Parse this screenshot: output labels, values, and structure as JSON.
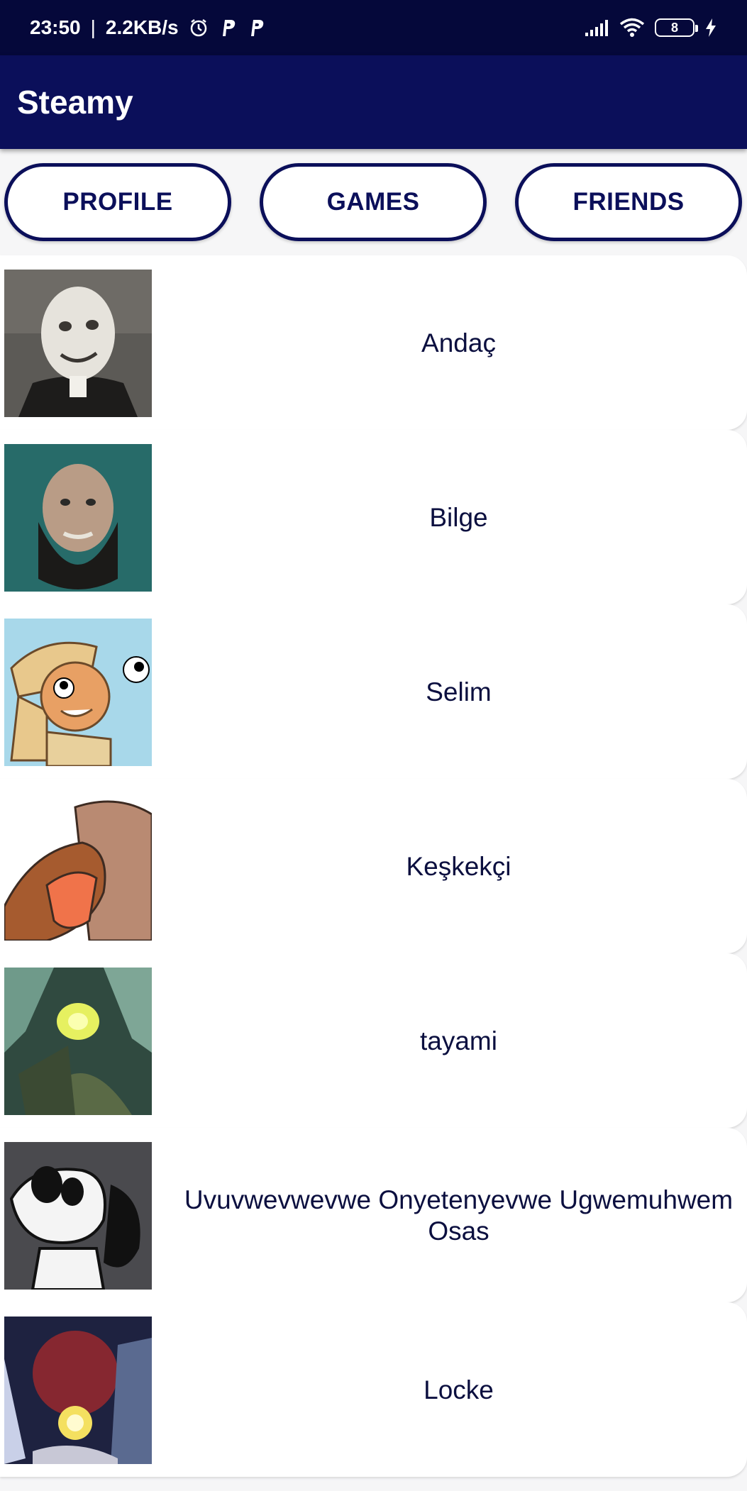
{
  "status_bar": {
    "time": "23:50",
    "separator": "|",
    "net_speed": "2.2KB/s",
    "battery_level": "8",
    "icons": [
      "alarm-icon",
      "p-app-icon",
      "p-app-icon",
      "signal-icon",
      "wifi-icon",
      "battery-icon",
      "charging-icon"
    ]
  },
  "app_bar": {
    "title": "Steamy"
  },
  "tabs": [
    {
      "label": "PROFILE"
    },
    {
      "label": "GAMES"
    },
    {
      "label": "FRIENDS"
    }
  ],
  "friends": [
    {
      "name": "Andaç"
    },
    {
      "name": "Bilge"
    },
    {
      "name": "Selim"
    },
    {
      "name": "Keşkekçi"
    },
    {
      "name": "tayami"
    },
    {
      "name": "Uvuvwevwevwe Onyetenyevwe Ugwemuhwem Osas"
    },
    {
      "name": "Locke"
    }
  ],
  "colors": {
    "status_bar": "#05083a",
    "app_bar": "#0b0f5a",
    "accent": "#0b0f5a",
    "background": "#f6f6f7"
  }
}
